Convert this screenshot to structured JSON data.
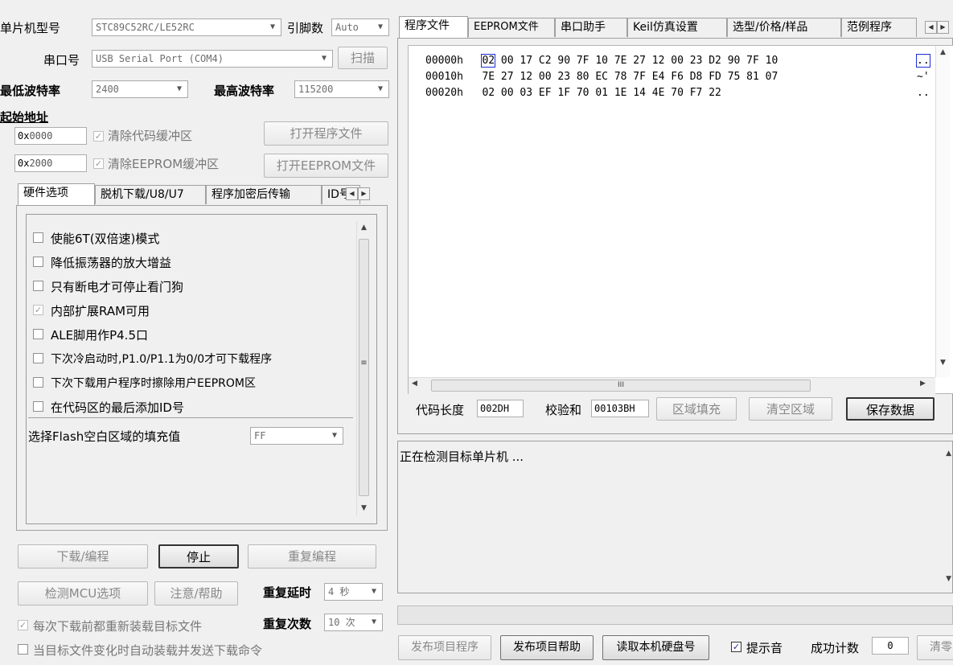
{
  "left": {
    "mcu_model_label": "单片机型号",
    "mcu_model_value": "STC89C52RC/LE52RC",
    "pins_label": "引脚数",
    "pins_value": "Auto",
    "port_label": "串口号",
    "port_value": "USB Serial Port (COM4)",
    "scan_button": "扫描",
    "min_baud_label": "最低波特率",
    "min_baud_value": "2400",
    "max_baud_label": "最高波特率",
    "max_baud_value": "115200",
    "start_addr_label": "起始地址",
    "addr1_prefix": "0x",
    "addr1_value": "0000",
    "clear_code_label": "清除代码缓冲区",
    "open_prog_button": "打开程序文件",
    "addr2_prefix": "0x",
    "addr2_value": "2000",
    "clear_eeprom_label": "清除EEPROM缓冲区",
    "open_eeprom_button": "打开EEPROM文件"
  },
  "hw_tabs": [
    "硬件选项",
    "脱机下载/U8/U7",
    "程序加密后传输",
    "ID号"
  ],
  "hw_options": [
    {
      "label": "使能6T(双倍速)模式",
      "checked": false
    },
    {
      "label": "降低振荡器的放大增益",
      "checked": false
    },
    {
      "label": "只有断电才可停止看门狗",
      "checked": false
    },
    {
      "label": "内部扩展RAM可用",
      "checked": true
    },
    {
      "label": "ALE脚用作P4.5口",
      "checked": false
    },
    {
      "label": "下次冷启动时,P1.0/P1.1为0/0才可下载程序",
      "checked": false
    },
    {
      "label": "下次下载用户程序时擦除用户EEPROM区",
      "checked": false
    },
    {
      "label": "在代码区的最后添加ID号",
      "checked": false
    }
  ],
  "fill_label": "选择Flash空白区域的填充值",
  "fill_value": "FF",
  "buttons": {
    "download": "下载/编程",
    "stop": "停止",
    "reprogram": "重复编程",
    "check_mcu": "检测MCU选项",
    "help": "注意/帮助",
    "repeat_delay_label": "重复延时",
    "repeat_delay_value": "4 秒",
    "repeat_count_label": "重复次数",
    "repeat_count_value": "10 次",
    "reload_label": "每次下载前都重新装载目标文件",
    "auto_send_label": "当目标文件变化时自动装载并发送下载命令"
  },
  "main_tabs": [
    "程序文件",
    "EEPROM文件",
    "串口助手",
    "Keil仿真设置",
    "选型/价格/样品",
    "范例程序"
  ],
  "hex_rows": [
    {
      "addr": "00000h",
      "bytes": "02 00 17 C2 90 7F 10 7E 27 12 00 23 D2 90 7F 10",
      "ascii": ".."
    },
    {
      "addr": "00010h",
      "bytes": "7E 27 12 00 23 80 EC 78 7F E4 F6 D8 FD 75 81 07",
      "ascii": "~'"
    },
    {
      "addr": "00020h",
      "bytes": "02 00 03 EF 1F 70 01 1E 14 4E 70 F7 22",
      "ascii": ".."
    }
  ],
  "hscroll_mid": "III",
  "code_bar": {
    "code_len_label": "代码长度",
    "code_len_value": "002DH",
    "checksum_label": "校验和",
    "checksum_value": "00103BH",
    "fill_area_button": "区域填充",
    "clear_area_button": "清空区域",
    "save_data_button": "保存数据"
  },
  "log_text": "正在检测目标单片机 ...",
  "bottom": {
    "publish_button": "发布项目程序",
    "publish_help_button": "发布项目帮助",
    "read_disk_button": "读取本机硬盘号",
    "beep_label": "提示音",
    "success_label": "成功计数",
    "success_value": "0",
    "clear_button": "清零"
  }
}
